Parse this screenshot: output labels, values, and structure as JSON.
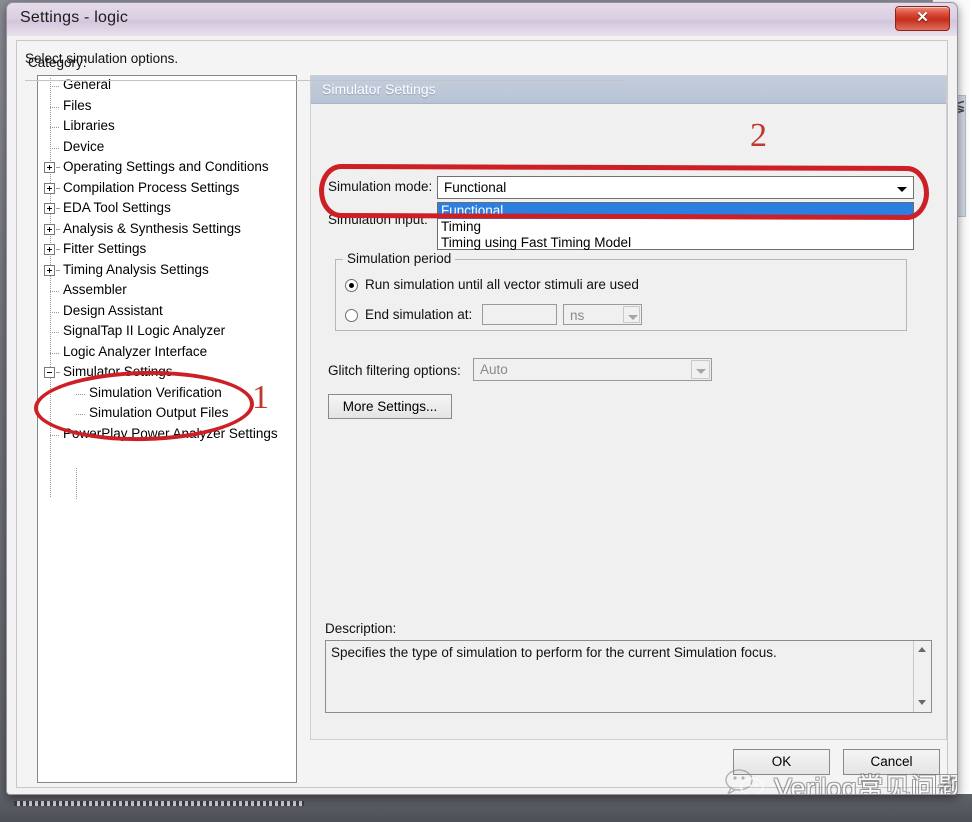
{
  "window": {
    "title": "Settings - logic",
    "close_label": "✕"
  },
  "sidebar": {
    "label": "Category:",
    "items": [
      {
        "label": "General",
        "level": 1,
        "toggle": "none"
      },
      {
        "label": "Files",
        "level": 1,
        "toggle": "none"
      },
      {
        "label": "Libraries",
        "level": 1,
        "toggle": "none"
      },
      {
        "label": "Device",
        "level": 1,
        "toggle": "none"
      },
      {
        "label": "Operating Settings and Conditions",
        "level": 1,
        "toggle": "plus"
      },
      {
        "label": "Compilation Process Settings",
        "level": 1,
        "toggle": "plus"
      },
      {
        "label": "EDA Tool Settings",
        "level": 1,
        "toggle": "plus"
      },
      {
        "label": "Analysis & Synthesis Settings",
        "level": 1,
        "toggle": "plus"
      },
      {
        "label": "Fitter Settings",
        "level": 1,
        "toggle": "plus"
      },
      {
        "label": "Timing Analysis Settings",
        "level": 1,
        "toggle": "plus"
      },
      {
        "label": "Assembler",
        "level": 1,
        "toggle": "none"
      },
      {
        "label": "Design Assistant",
        "level": 1,
        "toggle": "none"
      },
      {
        "label": "SignalTap II Logic Analyzer",
        "level": 1,
        "toggle": "none"
      },
      {
        "label": "Logic Analyzer Interface",
        "level": 1,
        "toggle": "none"
      },
      {
        "label": "Simulator Settings",
        "level": 1,
        "toggle": "minus"
      },
      {
        "label": "Simulation Verification",
        "level": 2,
        "toggle": "none"
      },
      {
        "label": "Simulation Output Files",
        "level": 2,
        "toggle": "none"
      },
      {
        "label": "PowerPlay Power Analyzer Settings",
        "level": 1,
        "toggle": "none"
      }
    ]
  },
  "panel": {
    "title": "Simulator Settings",
    "subtitle": "Select simulation options.",
    "simulation_mode_label": "Simulation mode:",
    "simulation_mode_value": "Functional",
    "simulation_mode_options": [
      "Functional",
      "Timing",
      "Timing using Fast Timing Model"
    ],
    "simulation_mode_selected_index": 0,
    "simulation_input_label": "Simulation input:",
    "simulation_period": {
      "legend": "Simulation period",
      "radio_run_all_label": "Run simulation until all vector stimuli are used",
      "radio_run_all_checked": true,
      "radio_end_at_label": "End simulation at:",
      "radio_end_at_checked": false,
      "end_time_value": "",
      "unit_value": "ns"
    },
    "glitch_label": "Glitch filtering options:",
    "glitch_value": "Auto",
    "more_settings_label": "More Settings...",
    "description_label": "Description:",
    "description_text": "Specifies the type of simulation to perform for the current Simulation focus."
  },
  "footer": {
    "ok_label": "OK",
    "cancel_label": "Cancel"
  },
  "annotations": [
    {
      "id": "1",
      "text": "1",
      "target": "simulator-settings-tree-group"
    },
    {
      "id": "2",
      "text": "2",
      "target": "simulation-mode-combo"
    }
  ],
  "watermark": {
    "text": "Verilog常见问题"
  },
  "colors": {
    "annotation_red": "#cc2026",
    "annotation_number": "#c0392b",
    "dropdown_highlight": "#2a7fe0",
    "panel_header": "#b8c4d6",
    "titlebar": "#dcd0e3",
    "close_button": "#c32f1c"
  }
}
